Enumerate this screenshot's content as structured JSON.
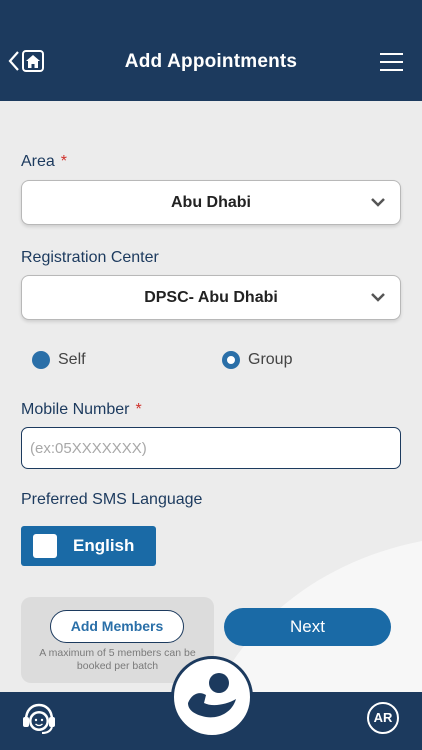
{
  "header": {
    "title": "Add Appointments",
    "back_icon": "chevron-left-icon",
    "home_icon": "home-icon",
    "menu_icon": "hamburger-menu-icon"
  },
  "form": {
    "area": {
      "label": "Area",
      "required_mark": "*",
      "value": "Abu Dhabi"
    },
    "registration_center": {
      "label": "Registration Center",
      "value": "DPSC- Abu Dhabi"
    },
    "booking_type": {
      "options": [
        {
          "label": "Self",
          "state": "filled"
        },
        {
          "label": "Group",
          "state": "selected-ring"
        }
      ]
    },
    "mobile": {
      "label": "Mobile Number",
      "required_mark": "*",
      "placeholder": "(ex:05XXXXXXX)",
      "value": ""
    },
    "sms_language": {
      "label": "Preferred SMS Language",
      "option": "English"
    }
  },
  "members": {
    "button_label": "Add Members",
    "note": "A maximum of 5 members can be booked per batch"
  },
  "next_label": "Next",
  "footer": {
    "support_icon": "customer-support-icon",
    "language_toggle": "AR",
    "logo_icon": "brand-logo-icon"
  },
  "colors": {
    "primary_dark": "#1c3a5e",
    "primary": "#1a6aa6",
    "required": "#d0302a",
    "background": "#ececec"
  }
}
